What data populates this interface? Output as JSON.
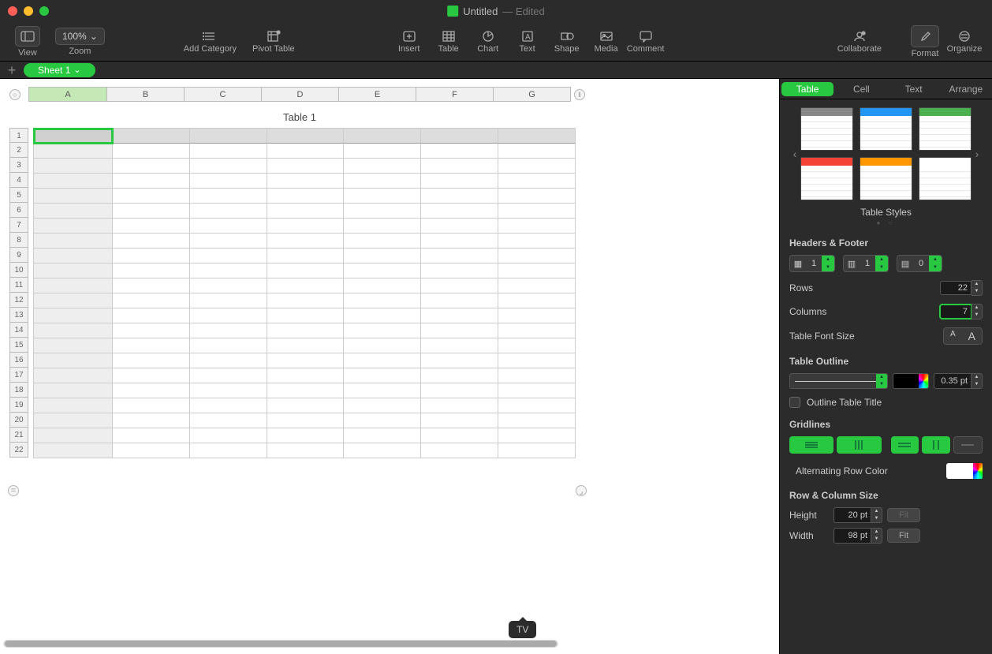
{
  "window": {
    "title": "Untitled",
    "edited": "— Edited"
  },
  "toolbar": {
    "view": "View",
    "zoom": "Zoom",
    "zoom_value": "100%",
    "add_category": "Add Category",
    "pivot_table": "Pivot Table",
    "insert": "Insert",
    "table": "Table",
    "chart": "Chart",
    "text": "Text",
    "shape": "Shape",
    "media": "Media",
    "comment": "Comment",
    "collaborate": "Collaborate",
    "format": "Format",
    "organize": "Organize"
  },
  "sheet_tab": "Sheet 1",
  "table_title": "Table 1",
  "columns": [
    "A",
    "B",
    "C",
    "D",
    "E",
    "F",
    "G"
  ],
  "rows": [
    "1",
    "2",
    "3",
    "4",
    "5",
    "6",
    "7",
    "8",
    "9",
    "10",
    "11",
    "12",
    "13",
    "14",
    "15",
    "16",
    "17",
    "18",
    "19",
    "20",
    "21",
    "22"
  ],
  "tooltip": "TV",
  "inspector": {
    "tabs": {
      "table": "Table",
      "cell": "Cell",
      "text": "Text",
      "arrange": "Arrange"
    },
    "styles_label": "Table Styles",
    "headers_footer": "Headers & Footer",
    "hf": {
      "header_rows": "1",
      "header_cols": "1",
      "footer_rows": "0"
    },
    "rows_label": "Rows",
    "rows_value": "22",
    "cols_label": "Columns",
    "cols_value": "7",
    "font_size_label": "Table Font Size",
    "outline_label": "Table Outline",
    "outline_pt": "0.35 pt",
    "outline_title": "Outline Table Title",
    "gridlines": "Gridlines",
    "alt_row": "Alternating Row Color",
    "row_col_size": "Row & Column Size",
    "height_label": "Height",
    "height_value": "20 pt",
    "width_label": "Width",
    "width_value": "98 pt",
    "fit": "Fit"
  }
}
